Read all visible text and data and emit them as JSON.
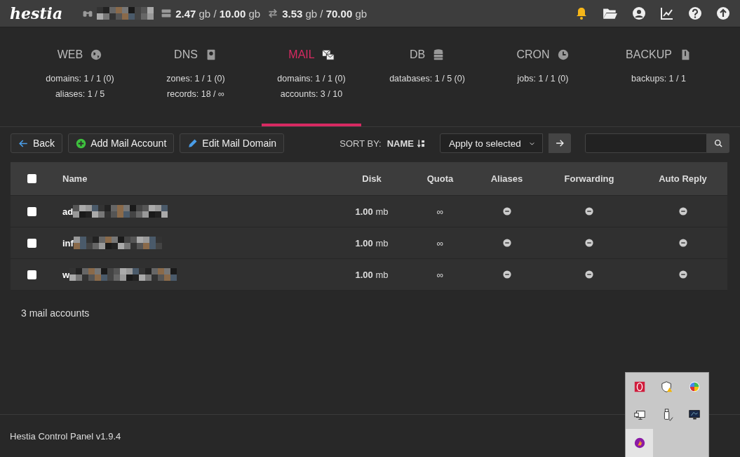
{
  "topbar": {
    "logo": "hestia",
    "disk": "**2.47** gb / **10.00** gb",
    "bandwidth": "**3.53** gb / **70.00** gb"
  },
  "tabs": [
    {
      "label": "WEB",
      "kind": "globe",
      "selected": false,
      "stats": [
        "domains: 1 / 1 (0)",
        "aliases: 1 / 5"
      ]
    },
    {
      "label": "DNS",
      "kind": "book",
      "selected": false,
      "stats": [
        "zones: 1 / 1 (0)",
        "records: 18 / ∞"
      ]
    },
    {
      "label": "MAIL",
      "kind": "mail",
      "selected": true,
      "stats": [
        "domains: 1 / 1 (0)",
        "accounts: 3 / 10"
      ]
    },
    {
      "label": "DB",
      "kind": "database",
      "selected": false,
      "stats": [
        "databases: 1 / 5 (0)"
      ]
    },
    {
      "label": "CRON",
      "kind": "clock",
      "selected": false,
      "stats": [
        "jobs: 1 / 1 (0)"
      ]
    },
    {
      "label": "BACKUP",
      "kind": "file",
      "selected": false,
      "stats": [
        "backups: 1 / 1"
      ]
    }
  ],
  "toolbar": {
    "back": "Back",
    "add": "Add Mail Account",
    "edit": "Edit Mail Domain",
    "sort_label": "SORT BY:",
    "sort_value": "NAME",
    "bulk_action": "Apply to selected"
  },
  "table": {
    "header_checked": false,
    "columns": [
      "Name",
      "Disk",
      "Quota",
      "Aliases",
      "Forwarding",
      "Auto Reply"
    ],
    "rows": [
      {
        "checked": false,
        "name": "ad",
        "disk": "**1.00** mb",
        "quota": "∞"
      },
      {
        "checked": false,
        "name": "inf",
        "disk": "**1.00** mb",
        "quota": "∞"
      },
      {
        "checked": false,
        "name": "w",
        "disk": "**1.00** mb",
        "quota": "∞"
      }
    ]
  },
  "summary": "3 mail accounts",
  "footer": "Hestia Control Panel v1.9.4"
}
